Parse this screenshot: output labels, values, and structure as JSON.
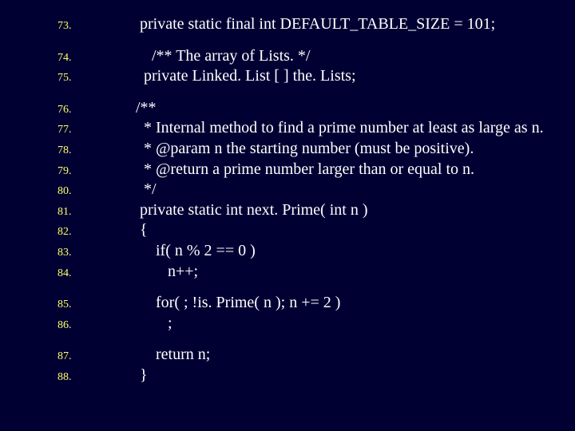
{
  "lines": [
    {
      "num": "73.",
      "kind": "code",
      "text": "     private static final int DEFAULT_TABLE_SIZE = 101;"
    },
    {
      "kind": "gap"
    },
    {
      "num": "74.",
      "kind": "code",
      "text": "        /** The array of Lists. */"
    },
    {
      "num": "75.",
      "kind": "code",
      "text": "      private Linked. List [ ] the. Lists;"
    },
    {
      "kind": "gap"
    },
    {
      "num": "76.",
      "kind": "code",
      "text": "    /**"
    },
    {
      "num": "77.",
      "kind": "code",
      "text": "      * Internal method to find a prime number at least as large as n."
    },
    {
      "num": "78.",
      "kind": "code",
      "text": "      * @param n the starting number (must be positive)."
    },
    {
      "num": "79.",
      "kind": "code",
      "text": "      * @return a prime number larger than or equal to n."
    },
    {
      "num": "80.",
      "kind": "code",
      "text": "      */"
    },
    {
      "num": "81.",
      "kind": "code",
      "text": "     private static int next. Prime( int n )"
    },
    {
      "num": "82.",
      "kind": "code",
      "text": "     {"
    },
    {
      "num": "83.",
      "kind": "code",
      "text": "         if( n % 2 == 0 )"
    },
    {
      "num": "84.",
      "kind": "code",
      "text": "            n++;"
    },
    {
      "kind": "gap"
    },
    {
      "num": "85.",
      "kind": "code",
      "text": "         for( ; !is. Prime( n ); n += 2 )"
    },
    {
      "num": "86.",
      "kind": "code",
      "text": "            ;"
    },
    {
      "kind": "gap"
    },
    {
      "num": "87.",
      "kind": "code",
      "text": "         return n;"
    },
    {
      "num": "88.",
      "kind": "code",
      "text": "     }"
    }
  ]
}
